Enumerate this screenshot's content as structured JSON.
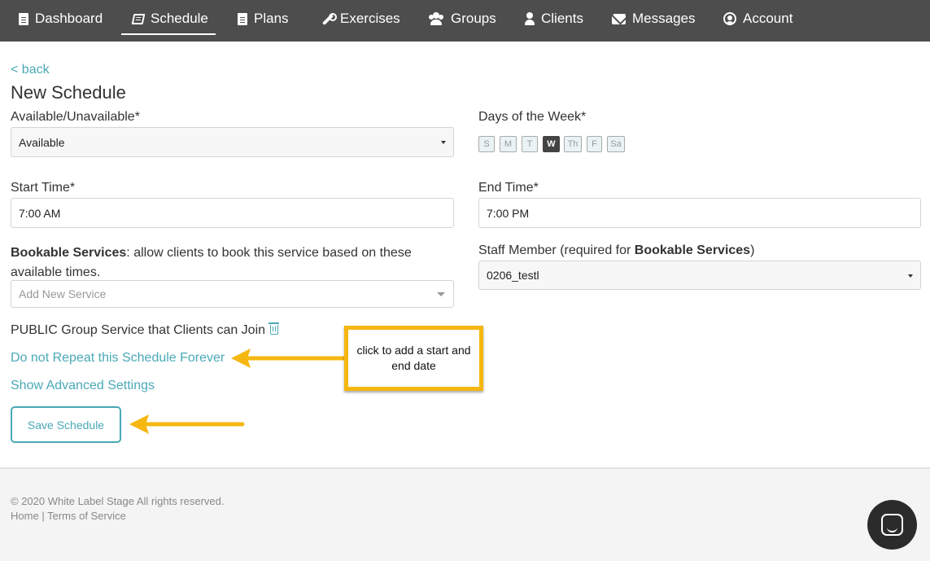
{
  "nav": {
    "items": [
      {
        "label": "Dashboard",
        "icon": "file-icon"
      },
      {
        "label": "Schedule",
        "icon": "book-icon",
        "active": true
      },
      {
        "label": "Plans",
        "icon": "file-text-icon"
      },
      {
        "label": "Exercises",
        "icon": "wrench-icon"
      },
      {
        "label": "Groups",
        "icon": "users-icon"
      },
      {
        "label": "Clients",
        "icon": "user-icon"
      },
      {
        "label": "Messages",
        "icon": "envelope-icon"
      },
      {
        "label": "Account",
        "icon": "account-circle-icon"
      }
    ]
  },
  "page": {
    "back_link": "< back",
    "title": "New Schedule"
  },
  "form": {
    "availability": {
      "label": "Available/Unavailable*",
      "value": "Available"
    },
    "days": {
      "label": "Days of the Week*",
      "items": [
        {
          "label": "S",
          "selected": false
        },
        {
          "label": "M",
          "selected": false
        },
        {
          "label": "T",
          "selected": false
        },
        {
          "label": "W",
          "selected": true
        },
        {
          "label": "Th",
          "selected": false
        },
        {
          "label": "F",
          "selected": false
        },
        {
          "label": "Sa",
          "selected": false
        }
      ]
    },
    "start_time": {
      "label": "Start Time*",
      "value": "7:00 AM"
    },
    "end_time": {
      "label": "End Time*",
      "value": "7:00 PM"
    },
    "bookable": {
      "label_bold": "Bookable Services",
      "label_rest_line1": ": allow clients to book this service based on these",
      "label_line2": "available times.",
      "placeholder": "Add New Service"
    },
    "staff": {
      "label_prefix": "Staff Member (required for ",
      "label_bold": "Bookable Services",
      "label_suffix": ")",
      "value": "0206_testl"
    },
    "public_group": "PUBLIC Group Service that Clients can Join",
    "repeat_link": "Do not Repeat this Schedule Forever",
    "advanced_link": "Show Advanced Settings",
    "save_label": "Save Schedule"
  },
  "annotation": {
    "text": "click to add a start and end date",
    "color": "#f5b710"
  },
  "footer": {
    "copyright": "© 2020 White Label Stage All rights reserved.",
    "home": "Home",
    "separator": "|",
    "terms": "Terms of Service"
  },
  "colors": {
    "accent": "#4aa9b7",
    "nav_bg": "#4d4d4d",
    "arrow": "#f5b710"
  }
}
